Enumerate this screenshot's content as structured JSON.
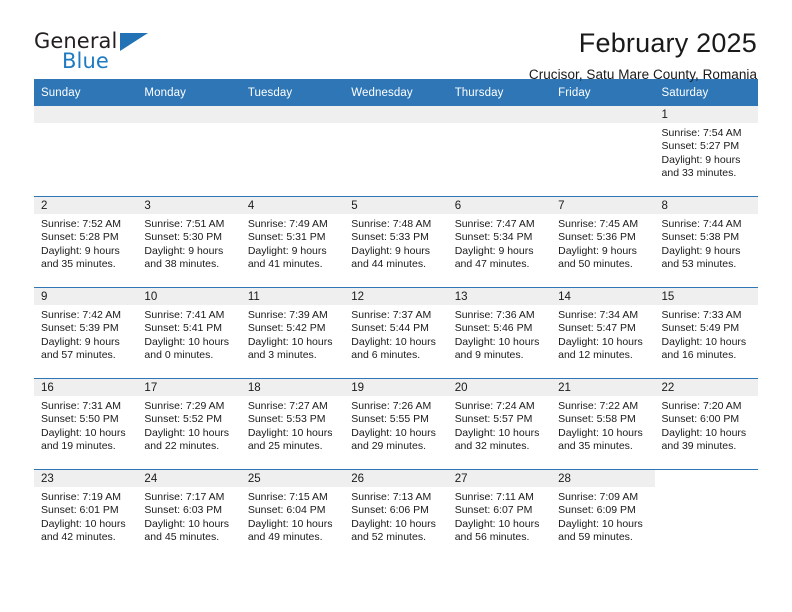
{
  "brand": {
    "name_top": "General",
    "name_bottom": "Blue",
    "triangle_color": "#2272b5",
    "blue_text_color": "#1f7bc1"
  },
  "header": {
    "month_title": "February 2025",
    "location": "Crucisor, Satu Mare County, Romania"
  },
  "theme": {
    "header_bg": "#2e76b6",
    "header_text": "#ffffff",
    "date_band_bg": "#efefef",
    "row_divider": "#2e76b6",
    "body_text": "#1a1a1a"
  },
  "calendar": {
    "weekday_headers": [
      "Sunday",
      "Monday",
      "Tuesday",
      "Wednesday",
      "Thursday",
      "Friday",
      "Saturday"
    ],
    "labels": {
      "sunrise": "Sunrise:",
      "sunset": "Sunset:",
      "daylight": "Daylight:"
    },
    "weeks": [
      [
        {
          "day": "",
          "empty": true
        },
        {
          "day": "",
          "empty": true
        },
        {
          "day": "",
          "empty": true
        },
        {
          "day": "",
          "empty": true
        },
        {
          "day": "",
          "empty": true
        },
        {
          "day": "",
          "empty": true
        },
        {
          "day": "1",
          "sunrise": "Sunrise: 7:54 AM",
          "sunset": "Sunset: 5:27 PM",
          "daylight_line1": "Daylight: 9 hours",
          "daylight_line2": "and 33 minutes."
        }
      ],
      [
        {
          "day": "2",
          "sunrise": "Sunrise: 7:52 AM",
          "sunset": "Sunset: 5:28 PM",
          "daylight_line1": "Daylight: 9 hours",
          "daylight_line2": "and 35 minutes."
        },
        {
          "day": "3",
          "sunrise": "Sunrise: 7:51 AM",
          "sunset": "Sunset: 5:30 PM",
          "daylight_line1": "Daylight: 9 hours",
          "daylight_line2": "and 38 minutes."
        },
        {
          "day": "4",
          "sunrise": "Sunrise: 7:49 AM",
          "sunset": "Sunset: 5:31 PM",
          "daylight_line1": "Daylight: 9 hours",
          "daylight_line2": "and 41 minutes."
        },
        {
          "day": "5",
          "sunrise": "Sunrise: 7:48 AM",
          "sunset": "Sunset: 5:33 PM",
          "daylight_line1": "Daylight: 9 hours",
          "daylight_line2": "and 44 minutes."
        },
        {
          "day": "6",
          "sunrise": "Sunrise: 7:47 AM",
          "sunset": "Sunset: 5:34 PM",
          "daylight_line1": "Daylight: 9 hours",
          "daylight_line2": "and 47 minutes."
        },
        {
          "day": "7",
          "sunrise": "Sunrise: 7:45 AM",
          "sunset": "Sunset: 5:36 PM",
          "daylight_line1": "Daylight: 9 hours",
          "daylight_line2": "and 50 minutes."
        },
        {
          "day": "8",
          "sunrise": "Sunrise: 7:44 AM",
          "sunset": "Sunset: 5:38 PM",
          "daylight_line1": "Daylight: 9 hours",
          "daylight_line2": "and 53 minutes."
        }
      ],
      [
        {
          "day": "9",
          "sunrise": "Sunrise: 7:42 AM",
          "sunset": "Sunset: 5:39 PM",
          "daylight_line1": "Daylight: 9 hours",
          "daylight_line2": "and 57 minutes."
        },
        {
          "day": "10",
          "sunrise": "Sunrise: 7:41 AM",
          "sunset": "Sunset: 5:41 PM",
          "daylight_line1": "Daylight: 10 hours",
          "daylight_line2": "and 0 minutes."
        },
        {
          "day": "11",
          "sunrise": "Sunrise: 7:39 AM",
          "sunset": "Sunset: 5:42 PM",
          "daylight_line1": "Daylight: 10 hours",
          "daylight_line2": "and 3 minutes."
        },
        {
          "day": "12",
          "sunrise": "Sunrise: 7:37 AM",
          "sunset": "Sunset: 5:44 PM",
          "daylight_line1": "Daylight: 10 hours",
          "daylight_line2": "and 6 minutes."
        },
        {
          "day": "13",
          "sunrise": "Sunrise: 7:36 AM",
          "sunset": "Sunset: 5:46 PM",
          "daylight_line1": "Daylight: 10 hours",
          "daylight_line2": "and 9 minutes."
        },
        {
          "day": "14",
          "sunrise": "Sunrise: 7:34 AM",
          "sunset": "Sunset: 5:47 PM",
          "daylight_line1": "Daylight: 10 hours",
          "daylight_line2": "and 12 minutes."
        },
        {
          "day": "15",
          "sunrise": "Sunrise: 7:33 AM",
          "sunset": "Sunset: 5:49 PM",
          "daylight_line1": "Daylight: 10 hours",
          "daylight_line2": "and 16 minutes."
        }
      ],
      [
        {
          "day": "16",
          "sunrise": "Sunrise: 7:31 AM",
          "sunset": "Sunset: 5:50 PM",
          "daylight_line1": "Daylight: 10 hours",
          "daylight_line2": "and 19 minutes."
        },
        {
          "day": "17",
          "sunrise": "Sunrise: 7:29 AM",
          "sunset": "Sunset: 5:52 PM",
          "daylight_line1": "Daylight: 10 hours",
          "daylight_line2": "and 22 minutes."
        },
        {
          "day": "18",
          "sunrise": "Sunrise: 7:27 AM",
          "sunset": "Sunset: 5:53 PM",
          "daylight_line1": "Daylight: 10 hours",
          "daylight_line2": "and 25 minutes."
        },
        {
          "day": "19",
          "sunrise": "Sunrise: 7:26 AM",
          "sunset": "Sunset: 5:55 PM",
          "daylight_line1": "Daylight: 10 hours",
          "daylight_line2": "and 29 minutes."
        },
        {
          "day": "20",
          "sunrise": "Sunrise: 7:24 AM",
          "sunset": "Sunset: 5:57 PM",
          "daylight_line1": "Daylight: 10 hours",
          "daylight_line2": "and 32 minutes."
        },
        {
          "day": "21",
          "sunrise": "Sunrise: 7:22 AM",
          "sunset": "Sunset: 5:58 PM",
          "daylight_line1": "Daylight: 10 hours",
          "daylight_line2": "and 35 minutes."
        },
        {
          "day": "22",
          "sunrise": "Sunrise: 7:20 AM",
          "sunset": "Sunset: 6:00 PM",
          "daylight_line1": "Daylight: 10 hours",
          "daylight_line2": "and 39 minutes."
        }
      ],
      [
        {
          "day": "23",
          "sunrise": "Sunrise: 7:19 AM",
          "sunset": "Sunset: 6:01 PM",
          "daylight_line1": "Daylight: 10 hours",
          "daylight_line2": "and 42 minutes."
        },
        {
          "day": "24",
          "sunrise": "Sunrise: 7:17 AM",
          "sunset": "Sunset: 6:03 PM",
          "daylight_line1": "Daylight: 10 hours",
          "daylight_line2": "and 45 minutes."
        },
        {
          "day": "25",
          "sunrise": "Sunrise: 7:15 AM",
          "sunset": "Sunset: 6:04 PM",
          "daylight_line1": "Daylight: 10 hours",
          "daylight_line2": "and 49 minutes."
        },
        {
          "day": "26",
          "sunrise": "Sunrise: 7:13 AM",
          "sunset": "Sunset: 6:06 PM",
          "daylight_line1": "Daylight: 10 hours",
          "daylight_line2": "and 52 minutes."
        },
        {
          "day": "27",
          "sunrise": "Sunrise: 7:11 AM",
          "sunset": "Sunset: 6:07 PM",
          "daylight_line1": "Daylight: 10 hours",
          "daylight_line2": "and 56 minutes."
        },
        {
          "day": "28",
          "sunrise": "Sunrise: 7:09 AM",
          "sunset": "Sunset: 6:09 PM",
          "daylight_line1": "Daylight: 10 hours",
          "daylight_line2": "and 59 minutes."
        },
        {
          "day": "",
          "empty": true,
          "no_band": true
        }
      ]
    ]
  }
}
